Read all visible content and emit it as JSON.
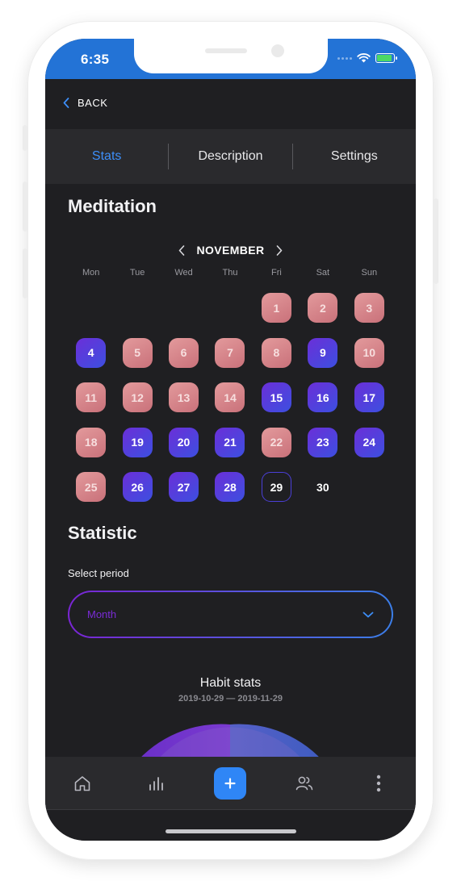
{
  "status_bar": {
    "time": "6:35"
  },
  "nav": {
    "back_label": "BACK"
  },
  "tabs": [
    {
      "label": "Stats",
      "active": true
    },
    {
      "label": "Description",
      "active": false
    },
    {
      "label": "Settings",
      "active": false
    }
  ],
  "habit": {
    "name": "Meditation"
  },
  "calendar": {
    "month": "NOVEMBER",
    "weekdays": [
      "Mon",
      "Tue",
      "Wed",
      "Thu",
      "Fri",
      "Sat",
      "Sun"
    ],
    "leading_blanks": 4,
    "days": [
      {
        "d": "1",
        "s": "missed"
      },
      {
        "d": "2",
        "s": "missed"
      },
      {
        "d": "3",
        "s": "missed"
      },
      {
        "d": "4",
        "s": "done"
      },
      {
        "d": "5",
        "s": "missed"
      },
      {
        "d": "6",
        "s": "missed"
      },
      {
        "d": "7",
        "s": "missed"
      },
      {
        "d": "8",
        "s": "missed"
      },
      {
        "d": "9",
        "s": "done"
      },
      {
        "d": "10",
        "s": "missed"
      },
      {
        "d": "11",
        "s": "missed"
      },
      {
        "d": "12",
        "s": "missed"
      },
      {
        "d": "13",
        "s": "missed"
      },
      {
        "d": "14",
        "s": "missed"
      },
      {
        "d": "15",
        "s": "done"
      },
      {
        "d": "16",
        "s": "done"
      },
      {
        "d": "17",
        "s": "done"
      },
      {
        "d": "18",
        "s": "missed"
      },
      {
        "d": "19",
        "s": "done"
      },
      {
        "d": "20",
        "s": "done"
      },
      {
        "d": "21",
        "s": "done"
      },
      {
        "d": "22",
        "s": "missed"
      },
      {
        "d": "23",
        "s": "done"
      },
      {
        "d": "24",
        "s": "done"
      },
      {
        "d": "25",
        "s": "missed"
      },
      {
        "d": "26",
        "s": "done"
      },
      {
        "d": "27",
        "s": "done"
      },
      {
        "d": "28",
        "s": "done"
      },
      {
        "d": "29",
        "s": "today"
      },
      {
        "d": "30",
        "s": "plain"
      }
    ]
  },
  "statistic": {
    "title": "Statistic",
    "select_label": "Select period",
    "period_value": "Month",
    "habit_stats_title": "Habit stats",
    "date_range": "2019-10-29 — 2019-11-29"
  },
  "bottom_nav": {
    "items": [
      "home-icon",
      "bar-chart-icon",
      "plus-icon",
      "users-icon",
      "more-vertical-icon"
    ]
  },
  "colors": {
    "accent_blue": "#2f86f6",
    "status_bar": "#2373d6",
    "done_start": "#6b2fd8",
    "done_end": "#3c4fe0",
    "missed_start": "#e39a9c",
    "missed_end": "#c9717a"
  }
}
